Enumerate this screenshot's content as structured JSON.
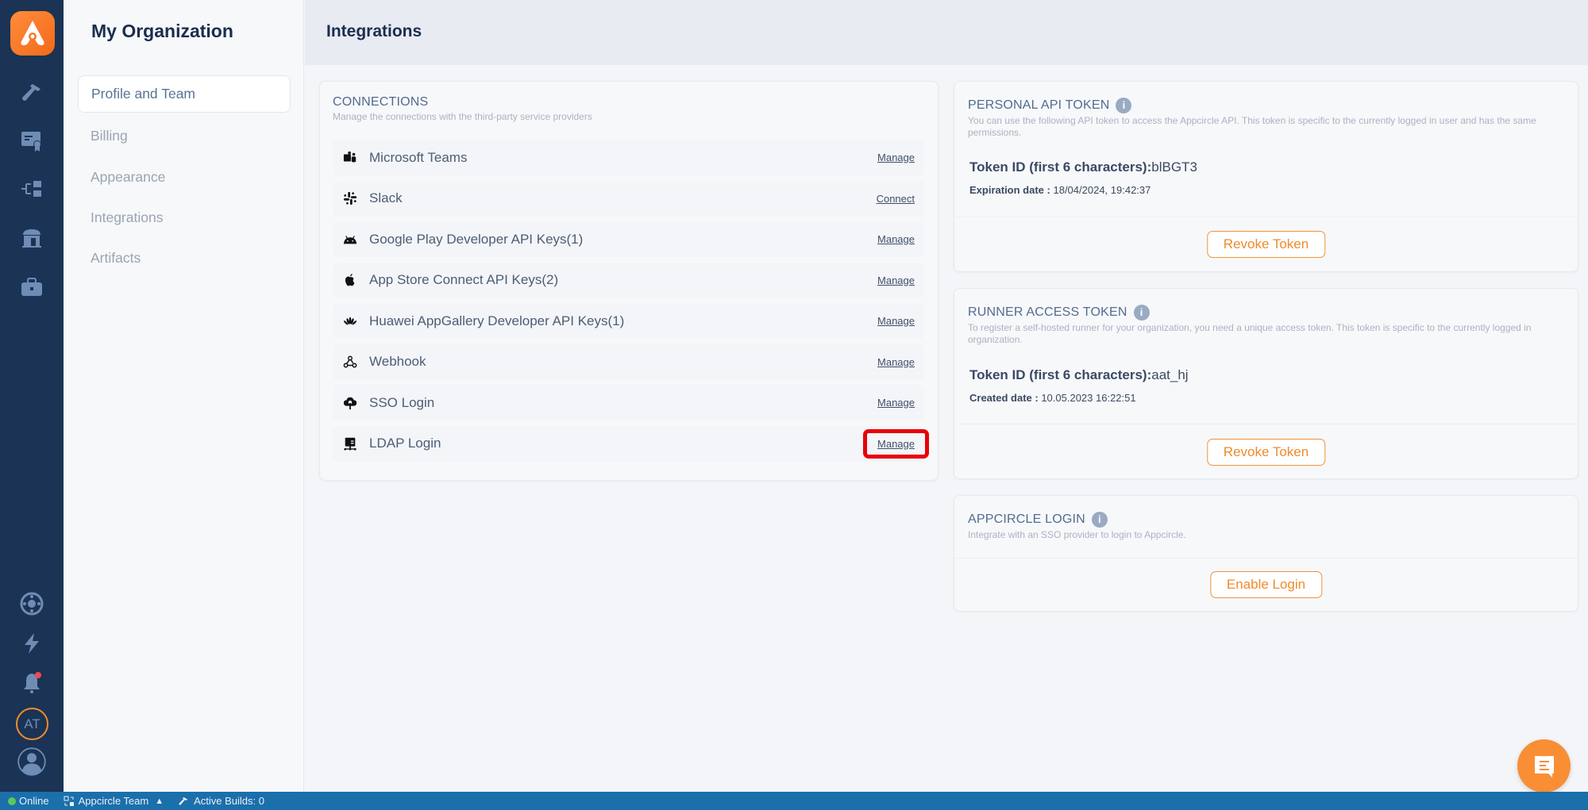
{
  "app": {
    "name": "Appcircle"
  },
  "rail": {
    "top_icons": [
      "build-icon",
      "signing-identities-icon",
      "distribution-icon",
      "enterprise-store-icon",
      "testing-portfolio-icon"
    ],
    "bottom_icons": [
      "help-icon",
      "whats-new-icon",
      "notifications-icon"
    ],
    "org_avatar": "AT",
    "notification_dot_color": "#ee4a55"
  },
  "subnav": {
    "title": "My Organization",
    "items": [
      {
        "label": "Profile and Team",
        "active": true
      },
      {
        "label": "Billing",
        "active": false
      },
      {
        "label": "Appearance",
        "active": false
      },
      {
        "label": "Integrations",
        "active": false
      },
      {
        "label": "Artifacts",
        "active": false
      }
    ]
  },
  "header": {
    "title": "Integrations"
  },
  "connections": {
    "title": "CONNECTIONS",
    "subtitle": "Manage the connections with the third-party service providers",
    "items": [
      {
        "icon": "microsoft-teams-icon",
        "name": "Microsoft Teams",
        "action": "Manage"
      },
      {
        "icon": "slack-icon",
        "name": "Slack",
        "action": "Connect"
      },
      {
        "icon": "android-icon",
        "name": "Google Play Developer API Keys(1)",
        "action": "Manage"
      },
      {
        "icon": "apple-icon",
        "name": "App Store Connect API Keys(2)",
        "action": "Manage"
      },
      {
        "icon": "huawei-icon",
        "name": "Huawei AppGallery Developer API Keys(1)",
        "action": "Manage"
      },
      {
        "icon": "webhook-icon",
        "name": "Webhook",
        "action": "Manage"
      },
      {
        "icon": "sso-icon",
        "name": "SSO Login",
        "action": "Manage"
      },
      {
        "icon": "ldap-icon",
        "name": "LDAP Login",
        "action": "Manage",
        "highlighted": true
      }
    ]
  },
  "personal_token": {
    "title": "PERSONAL API TOKEN",
    "description": "You can use the following API token to access the Appcircle API. This token is specific to the currently logged in user and has the same permissions.",
    "token_label": "Token ID (first 6 characters):",
    "token_value": "blBGT3",
    "date_label": "Expiration date :",
    "date_value": "18/04/2024, 19:42:37",
    "button": "Revoke Token"
  },
  "runner_token": {
    "title": "RUNNER ACCESS TOKEN",
    "description": "To register a self-hosted runner for your organization, you need a unique access token. This token is specific to the currently logged in organization.",
    "token_label": "Token ID (first 6 characters):",
    "token_value": "aat_hj",
    "date_label": "Created date :",
    "date_value": "10.05.2023 16:22:51",
    "button": "Revoke Token"
  },
  "appcircle_login": {
    "title": "APPCIRCLE LOGIN",
    "description": "Integrate with an SSO provider to login to Appcircle.",
    "button": "Enable Login"
  },
  "statusbar": {
    "online": "Online",
    "team": "Appcircle Team",
    "active_builds": "Active Builds: 0"
  },
  "colors": {
    "accent": "#f98e34",
    "rail": "#1b3354",
    "statusbar": "#1b6fab",
    "highlight": "#e8000a"
  }
}
